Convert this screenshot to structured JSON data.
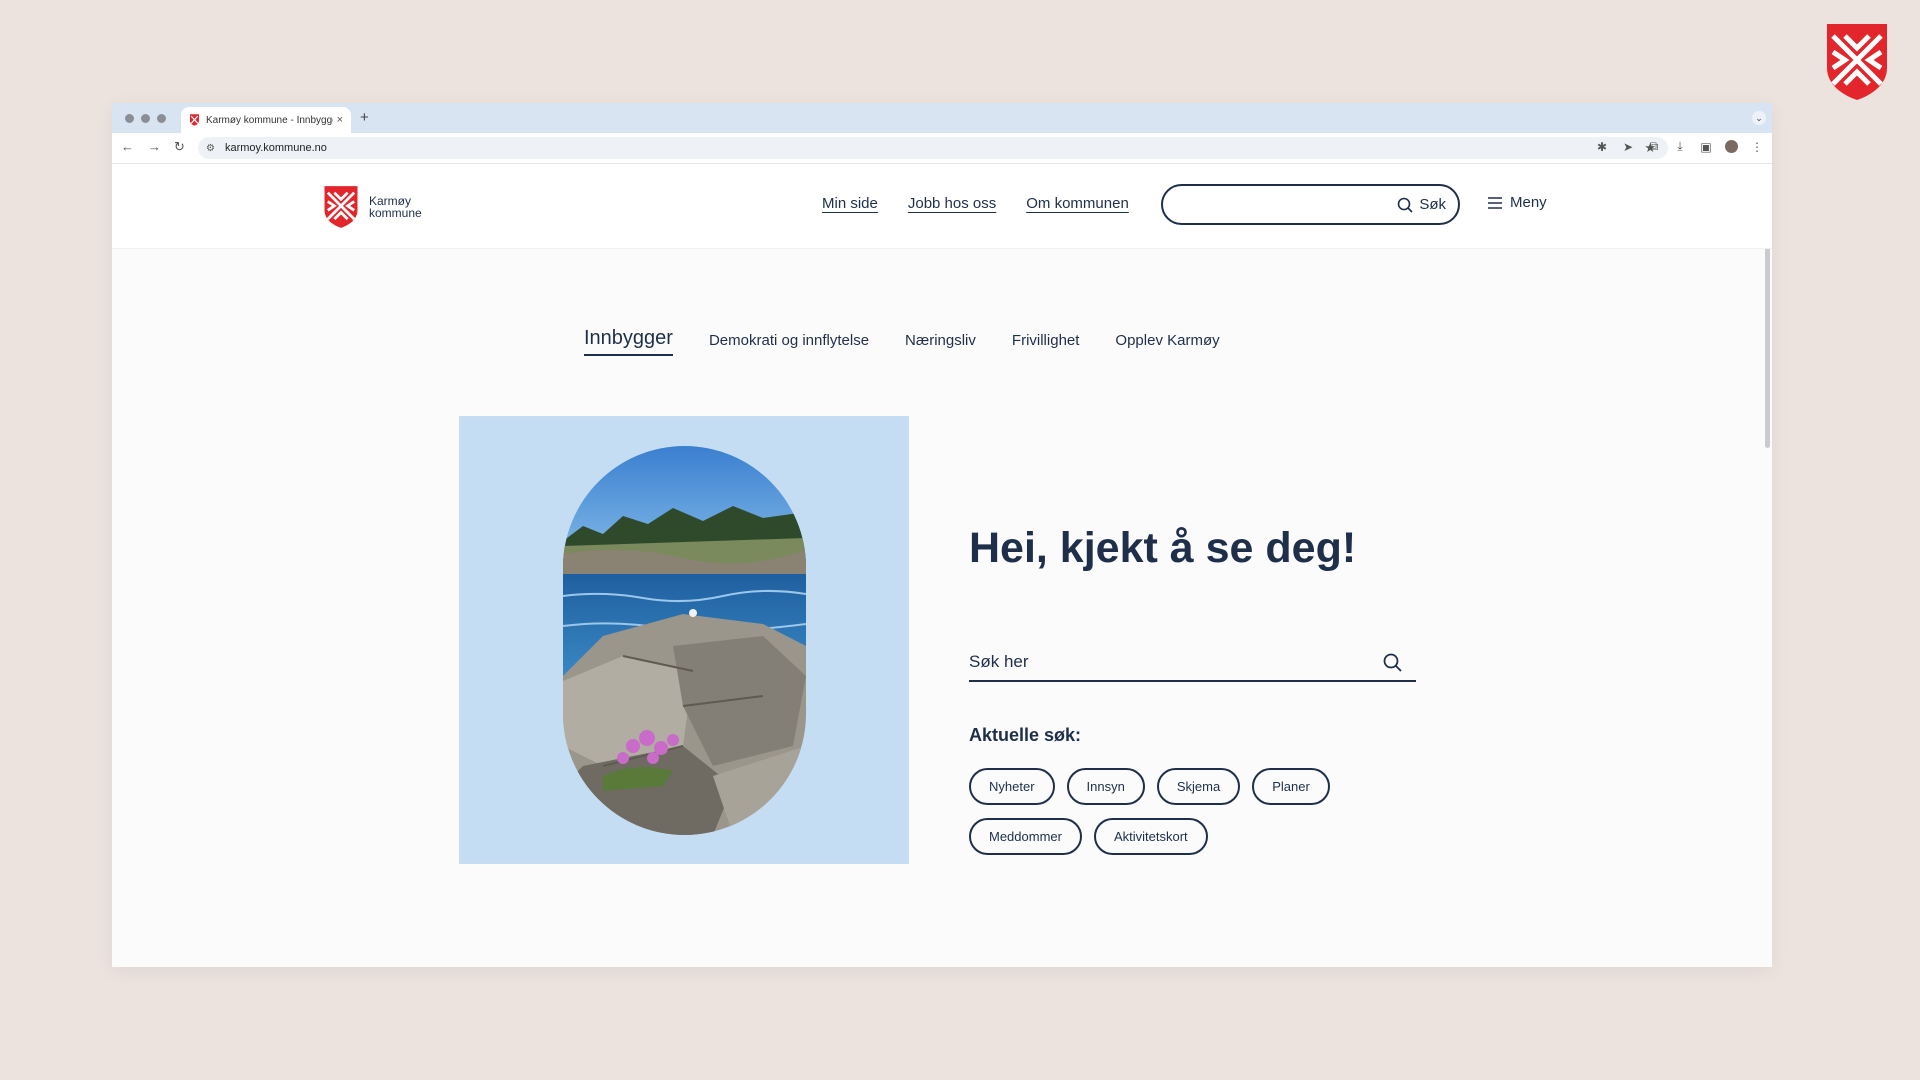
{
  "browser": {
    "tab_title": "Karmøy kommune - Innbygger",
    "tab_close": "×",
    "new_tab": "+",
    "url": "karmoy.kommune.no",
    "nav_back": "←",
    "nav_forward": "→",
    "nav_reload": "↻"
  },
  "header": {
    "logo_line1": "Karmøy",
    "logo_line2": "kommune",
    "nav": [
      "Min side",
      "Jobb hos oss",
      "Om kommunen"
    ],
    "search_label": "Søk",
    "menu_label": "Meny"
  },
  "section_tabs": [
    "Innbygger",
    "Demokrati og innflytelse",
    "Næringsliv",
    "Frivillighet",
    "Opplev Karmøy"
  ],
  "hero": {
    "greeting": "Hei, kjekt å se deg!",
    "search_placeholder": "Søk her",
    "aktuelle_label": "Aktuelle søk:",
    "chips": [
      "Nyheter",
      "Innsyn",
      "Skjema",
      "Planer",
      "Meddommer",
      "Aktivitetskort"
    ]
  },
  "colors": {
    "brand_red": "#e2262c",
    "text_navy": "#1f2f4a",
    "hero_bg": "#c4ddf2",
    "page_bg": "#ece3de"
  }
}
